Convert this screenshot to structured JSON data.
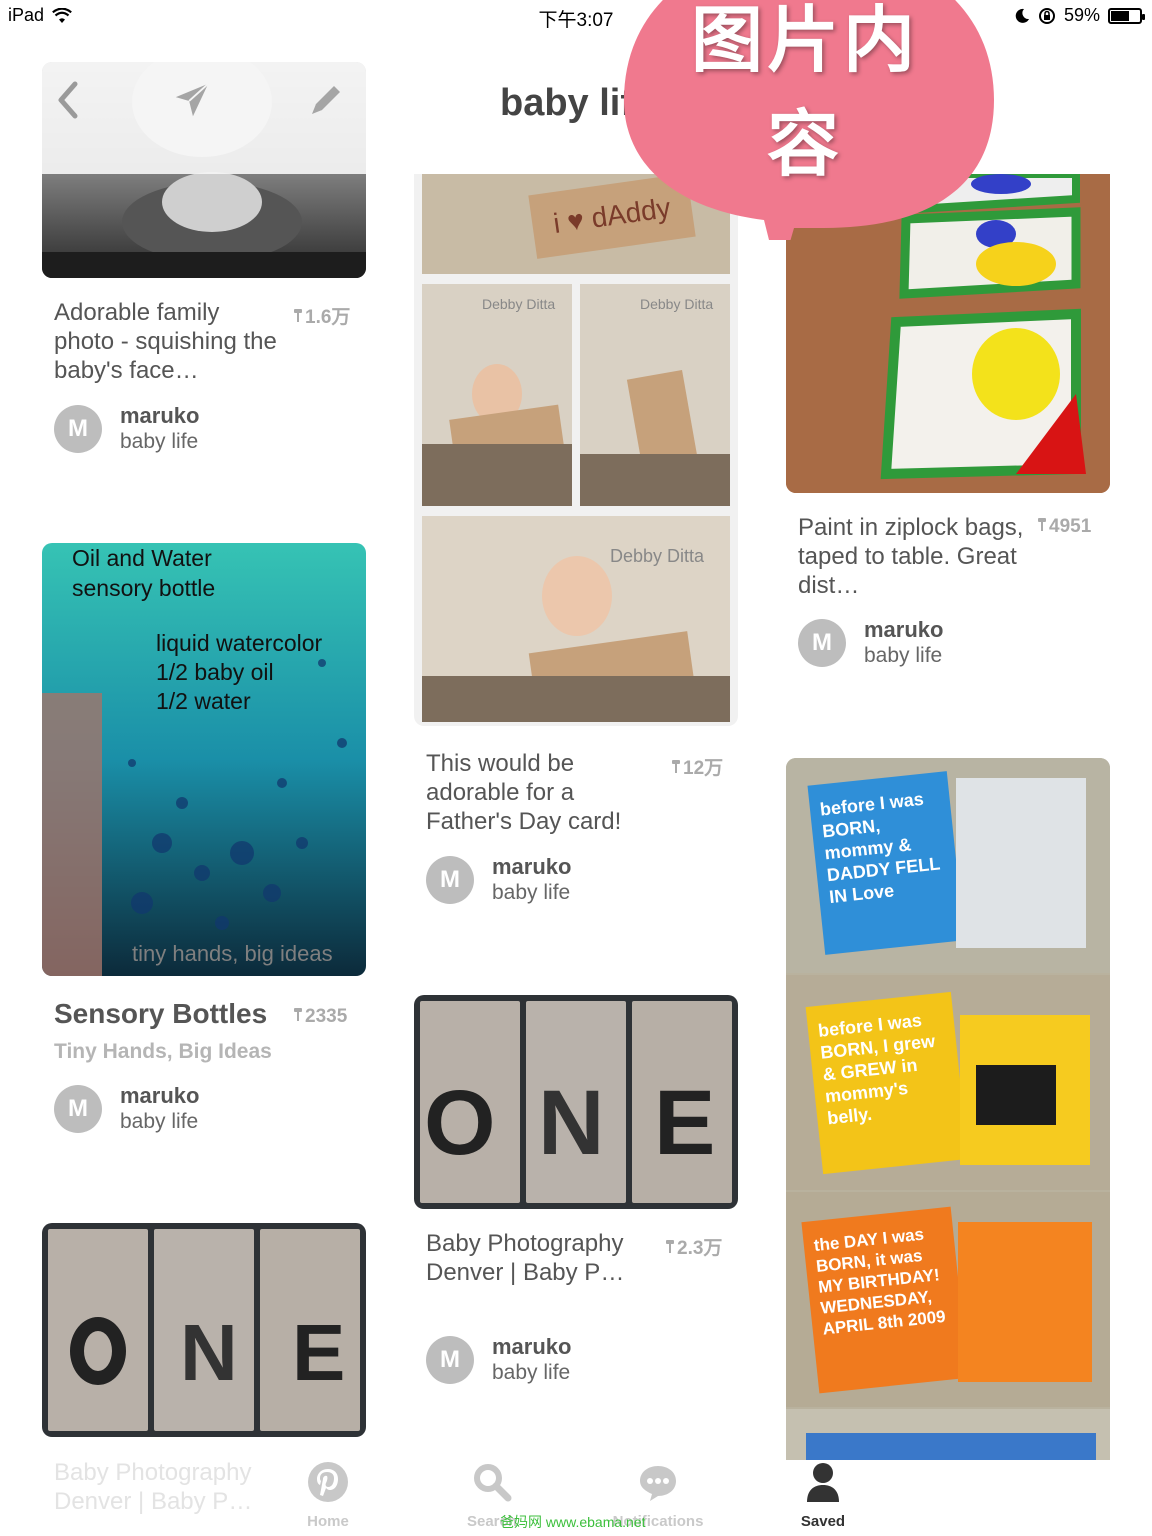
{
  "status_bar": {
    "device": "iPad",
    "time": "下午3:07",
    "battery": "59%",
    "battery_level": 0.59
  },
  "board": {
    "title": "baby life"
  },
  "overlay": {
    "text_line1": "图片内",
    "text_line2": "容",
    "color": "#f0798e"
  },
  "header_icons": [
    "back-icon",
    "send-icon",
    "edit-icon"
  ],
  "pins": [
    {
      "title": "Adorable family photo - squishing the baby's face…",
      "count": "1.6万",
      "user": "maruko",
      "board": "baby life",
      "avatar_letter": "M"
    },
    {
      "title": "Sensory Bottles",
      "subtitle": "Tiny Hands, Big Ideas",
      "count": "2335",
      "user": "maruko",
      "board": "baby life",
      "avatar_letter": "M",
      "image_text": {
        "t1": "Oil and Water",
        "t2": "sensory bottle",
        "t3": "liquid watercolor",
        "t4": "1/2 baby oil",
        "t5": "1/2 water",
        "t6": "tiny hands, big ideas"
      }
    },
    {
      "title": "Baby Photography Denver | Baby P…",
      "faded": true
    },
    {
      "title": "This would be adorable for a Father's Day card!",
      "count": "12万",
      "user": "maruko",
      "board": "baby life",
      "avatar_letter": "M",
      "image_text": {
        "sign": "i ♥ dAddy",
        "studio": "Debby Ditta"
      }
    },
    {
      "title": "Baby Photography Denver | Baby P…",
      "count": "2.3万",
      "user": "maruko",
      "board": "baby life",
      "avatar_letter": "M",
      "image_letters": [
        "O",
        "N",
        "E"
      ]
    },
    {
      "title": "Paint in ziplock bags, taped to table. Great dist…",
      "count": "4951",
      "user": "maruko",
      "board": "baby life",
      "avatar_letter": "M"
    },
    {
      "book_pages": [
        {
          "text": "before I was BORN, mommy & DADDY FELL IN Love",
          "color": "#2f8fd8"
        },
        {
          "text": "before I was BORN, I grew & GREW in mommy's belly.",
          "color": "#f3c418"
        },
        {
          "text": "the DAY I was BORN, it was MY BIRTHDAY! WEDNESDAY, APRIL 8th 2009",
          "color": "#f07a1e"
        }
      ]
    }
  ],
  "tabs": [
    {
      "label": "Home",
      "icon": "pinterest-logo-icon"
    },
    {
      "label": "Search",
      "icon": "search-icon"
    },
    {
      "label": "Notifications",
      "icon": "chat-bubble-icon"
    },
    {
      "label": "Saved",
      "icon": "profile-icon",
      "active": true
    }
  ],
  "watermark": "爸妈网  www.ebama.net"
}
